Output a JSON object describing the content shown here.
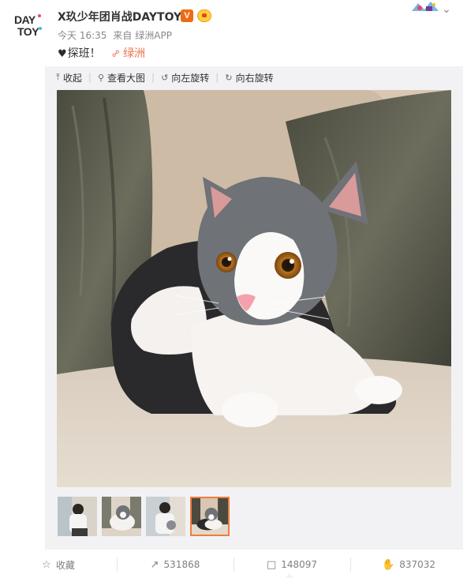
{
  "header": {
    "avatar_text_line1": "DAY",
    "avatar_text_line2": "TOY",
    "username": "X玖少年团肖战DAYTOY",
    "verified_badge": "V",
    "time": "今天 16:35",
    "source_prefix": "来自",
    "source": "绿洲APP"
  },
  "post": {
    "text": "探班！",
    "heart_icon": "black-heart-icon",
    "link_text": "绿洲"
  },
  "toolbar": {
    "collapse": "收起",
    "view_large": "查看大图",
    "rotate_left": "向左旋转",
    "rotate_right": "向右旋转"
  },
  "thumbnails": [
    {
      "name": "thumb-person-1",
      "active": false
    },
    {
      "name": "thumb-cat-1",
      "active": false
    },
    {
      "name": "thumb-person-2",
      "active": false
    },
    {
      "name": "thumb-cat-2",
      "active": true
    }
  ],
  "actions": {
    "favorite": "收藏",
    "repost_count": "531868",
    "comment_count": "148097",
    "like_count": "837032"
  },
  "colors": {
    "accent_orange": "#eb7350",
    "verified_orange": "#f06a12",
    "thumb_border": "#f07c3b",
    "muted_text": "#888888",
    "panel_bg": "#f2f2f5"
  }
}
